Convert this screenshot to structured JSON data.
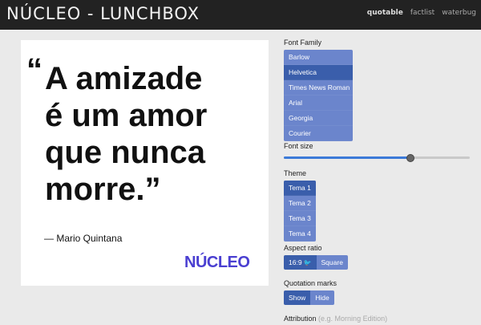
{
  "header": {
    "title": "NÚCLEO - LUNCHBOX",
    "nav": [
      "quotable",
      "factlist",
      "waterbug"
    ],
    "active": "quotable"
  },
  "card": {
    "open_mark": "“",
    "quote_lines": [
      "A amizade",
      "é um amor",
      "que nunca",
      "morre.”"
    ],
    "attribution": "— Mario Quintana",
    "logo": "NÚCLEO"
  },
  "controls": {
    "font_family": {
      "label": "Font Family",
      "options": [
        "Barlow",
        "Helvetica",
        "Times News Roman",
        "Arial",
        "Georgia",
        "Courier"
      ],
      "selected": "Helvetica"
    },
    "font_size": {
      "label": "Font size",
      "value_fraction": 0.68
    },
    "theme": {
      "label": "Theme",
      "options": [
        "Tema 1",
        "Tema 2",
        "Tema 3",
        "Tema 4"
      ],
      "selected": "Tema 1"
    },
    "aspect_ratio": {
      "label": "Aspect ratio",
      "options": [
        "16:9",
        "Square"
      ],
      "selected": "16:9",
      "icon": "twitter-bird-icon"
    },
    "quotation_marks": {
      "label": "Quotation marks",
      "options": [
        "Show",
        "Hide"
      ],
      "selected": "Show"
    },
    "attribution": {
      "label": "Attribution",
      "placeholder": "(e.g. Morning Edition)"
    }
  },
  "colors": {
    "header_bg": "#222222",
    "button": "#6b85cc",
    "button_selected": "#3a5eab",
    "slider": "#3c7ad8",
    "logo": "#4a3fd1"
  }
}
